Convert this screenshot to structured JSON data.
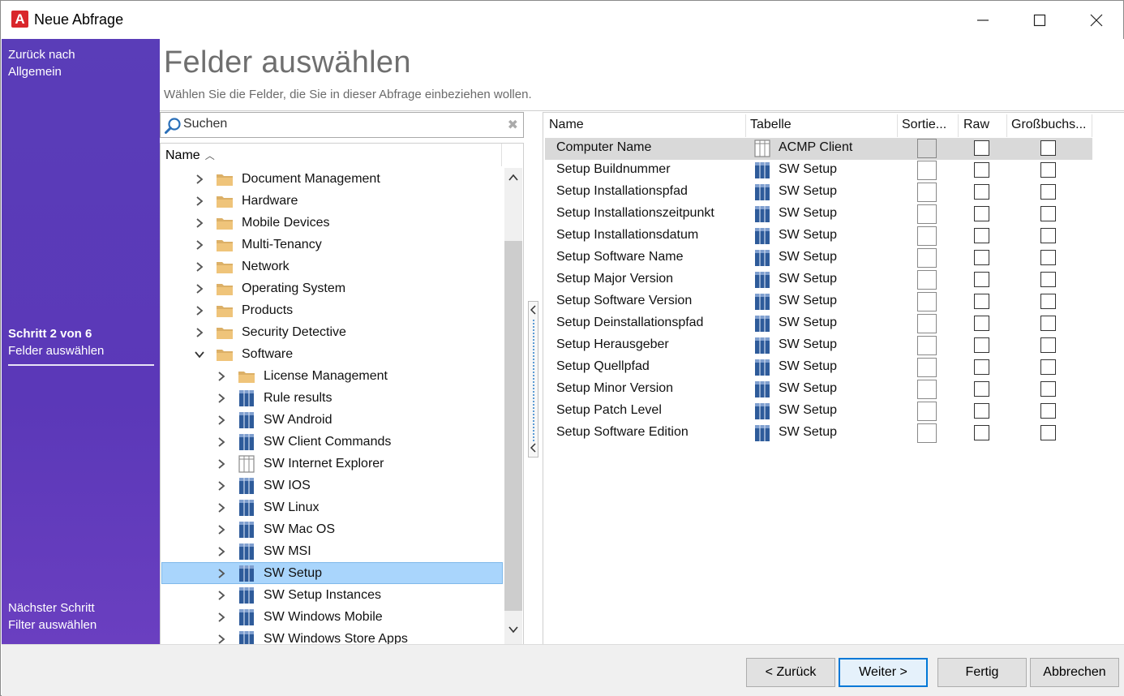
{
  "window": {
    "title": "Neue Abfrage",
    "app_icon_letter": "A"
  },
  "sidebar": {
    "back_line1": "Zurück nach",
    "back_line2": "Allgemein",
    "step_label": "Schritt 2 von 6",
    "step_title": "Felder auswählen",
    "next_line1": "Nächster Schritt",
    "next_line2": "Filter auswählen"
  },
  "page": {
    "heading": "Felder auswählen",
    "subheading": "Wählen Sie die Felder, die Sie in dieser Abfrage einbeziehen wollen."
  },
  "search": {
    "placeholder": "Suchen"
  },
  "tree": {
    "header": "Name",
    "items": [
      {
        "label": "Document Management",
        "icon": "folder-icon",
        "level": 0,
        "expanded": false
      },
      {
        "label": "Hardware",
        "icon": "folder-icon",
        "level": 0,
        "expanded": false
      },
      {
        "label": "Mobile Devices",
        "icon": "folder-icon",
        "level": 0,
        "expanded": false
      },
      {
        "label": "Multi-Tenancy",
        "icon": "folder-icon",
        "level": 0,
        "expanded": false
      },
      {
        "label": "Network",
        "icon": "folder-icon",
        "level": 0,
        "expanded": false
      },
      {
        "label": "Operating System",
        "icon": "folder-icon",
        "level": 0,
        "expanded": false
      },
      {
        "label": "Products",
        "icon": "folder-icon",
        "level": 0,
        "expanded": false
      },
      {
        "label": "Security Detective",
        "icon": "folder-icon",
        "level": 0,
        "expanded": false
      },
      {
        "label": "Software",
        "icon": "folder-icon",
        "level": 0,
        "expanded": true
      },
      {
        "label": "License Management",
        "icon": "folder-icon",
        "level": 1,
        "expanded": false
      },
      {
        "label": "Rule results",
        "icon": "table-icon",
        "level": 1,
        "expanded": false
      },
      {
        "label": "SW Android",
        "icon": "table-icon",
        "level": 1,
        "expanded": false
      },
      {
        "label": "SW Client Commands",
        "icon": "table-icon",
        "level": 1,
        "expanded": false
      },
      {
        "label": "SW Internet Explorer",
        "icon": "table-outline-icon",
        "level": 1,
        "expanded": false
      },
      {
        "label": "SW IOS",
        "icon": "table-icon",
        "level": 1,
        "expanded": false
      },
      {
        "label": "SW Linux",
        "icon": "table-icon",
        "level": 1,
        "expanded": false
      },
      {
        "label": "SW Mac OS",
        "icon": "table-icon",
        "level": 1,
        "expanded": false
      },
      {
        "label": "SW MSI",
        "icon": "table-icon",
        "level": 1,
        "expanded": false
      },
      {
        "label": "SW Setup",
        "icon": "table-icon",
        "level": 1,
        "expanded": false,
        "selected": true
      },
      {
        "label": "SW Setup Instances",
        "icon": "table-icon",
        "level": 1,
        "expanded": false
      },
      {
        "label": "SW Windows Mobile",
        "icon": "table-icon",
        "level": 1,
        "expanded": false
      },
      {
        "label": "SW Windows Store Apps",
        "icon": "table-icon",
        "level": 1,
        "expanded": false
      }
    ]
  },
  "grid": {
    "columns": {
      "name": "Name",
      "table": "Tabelle",
      "sort": "Sortie...",
      "raw": "Raw",
      "upper": "Großbuchs..."
    },
    "rows": [
      {
        "name": "Computer Name",
        "table": "ACMP Client",
        "table_icon": "table-outline-icon"
      },
      {
        "name": "Setup Buildnummer",
        "table": "SW Setup",
        "table_icon": "table-icon"
      },
      {
        "name": "Setup Installationspfad",
        "table": "SW Setup",
        "table_icon": "table-icon"
      },
      {
        "name": "Setup Installationszeitpunkt",
        "table": "SW Setup",
        "table_icon": "table-icon"
      },
      {
        "name": "Setup Installationsdatum",
        "table": "SW Setup",
        "table_icon": "table-icon"
      },
      {
        "name": "Setup Software Name",
        "table": "SW Setup",
        "table_icon": "table-icon"
      },
      {
        "name": "Setup Major Version",
        "table": "SW Setup",
        "table_icon": "table-icon"
      },
      {
        "name": "Setup Software Version",
        "table": "SW Setup",
        "table_icon": "table-icon"
      },
      {
        "name": "Setup Deinstallationspfad",
        "table": "SW Setup",
        "table_icon": "table-icon"
      },
      {
        "name": "Setup Herausgeber",
        "table": "SW Setup",
        "table_icon": "table-icon"
      },
      {
        "name": "Setup Quellpfad",
        "table": "SW Setup",
        "table_icon": "table-icon"
      },
      {
        "name": "Setup Minor Version",
        "table": "SW Setup",
        "table_icon": "table-icon"
      },
      {
        "name": "Setup Patch Level",
        "table": "SW Setup",
        "table_icon": "table-icon"
      },
      {
        "name": "Setup Software Edition",
        "table": "SW Setup",
        "table_icon": "table-icon"
      }
    ]
  },
  "footer": {
    "back_button": "< Zurück",
    "next_button": "Weiter >",
    "finish_button": "Fertig",
    "cancel_button": "Abbrechen"
  },
  "colors": {
    "sidebar": "#5b38b8",
    "selection": "#a9d5fc",
    "accent": "#0078d7",
    "app_icon": "#d9262b",
    "folder": "#dcb067",
    "table_icon": "#2e5b9a"
  }
}
